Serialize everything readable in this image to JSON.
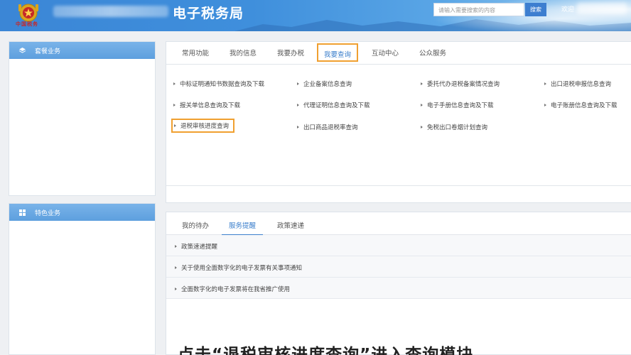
{
  "header": {
    "site_title": "电子税务局",
    "brand_sub": "中国税务",
    "search_placeholder": "请输入需要搜索的内容",
    "search_button": "搜索",
    "user_link": "欢迎"
  },
  "sidebar": {
    "panel1_title": "套餐业务",
    "panel2_title": "特色业务"
  },
  "main": {
    "tabs": [
      {
        "label": "常用功能"
      },
      {
        "label": "我的信息"
      },
      {
        "label": "我要办税"
      },
      {
        "label": "我要查询"
      },
      {
        "label": "互动中心"
      },
      {
        "label": "公众服务"
      }
    ],
    "active_tab": "我要查询",
    "links": [
      {
        "label": "中标证明通知书数据查询及下载"
      },
      {
        "label": "企业备案信息查询"
      },
      {
        "label": "委托代办退税备案情况查询"
      },
      {
        "label": "出口退税申报信息查询"
      },
      {
        "label": "报关单信息查询及下载"
      },
      {
        "label": "代理证明信息查询及下载"
      },
      {
        "label": "电子手册信息查询及下载"
      },
      {
        "label": "电子账册信息查询及下载"
      },
      {
        "label": "退税审核进度查询"
      },
      {
        "label": "出口商品退税率查询"
      },
      {
        "label": "免税出口卷烟计划查询"
      }
    ]
  },
  "notices": {
    "tabs": [
      {
        "label": "我的待办"
      },
      {
        "label": "服务提醒"
      },
      {
        "label": "政策速递"
      }
    ],
    "active_tab": "服务提醒",
    "items": [
      {
        "label": "政策速递提醒"
      },
      {
        "label": "关于使用全面数字化的电子发票有关事项通知"
      },
      {
        "label": "全面数字化的电子发票将在我省推广使用"
      }
    ]
  },
  "caption": "点击“退税审核进度查询”进入查询模块",
  "colors": {
    "accent": "#3b7fcc",
    "highlight": "#f0a030",
    "header_blue": "#3b86d6"
  }
}
